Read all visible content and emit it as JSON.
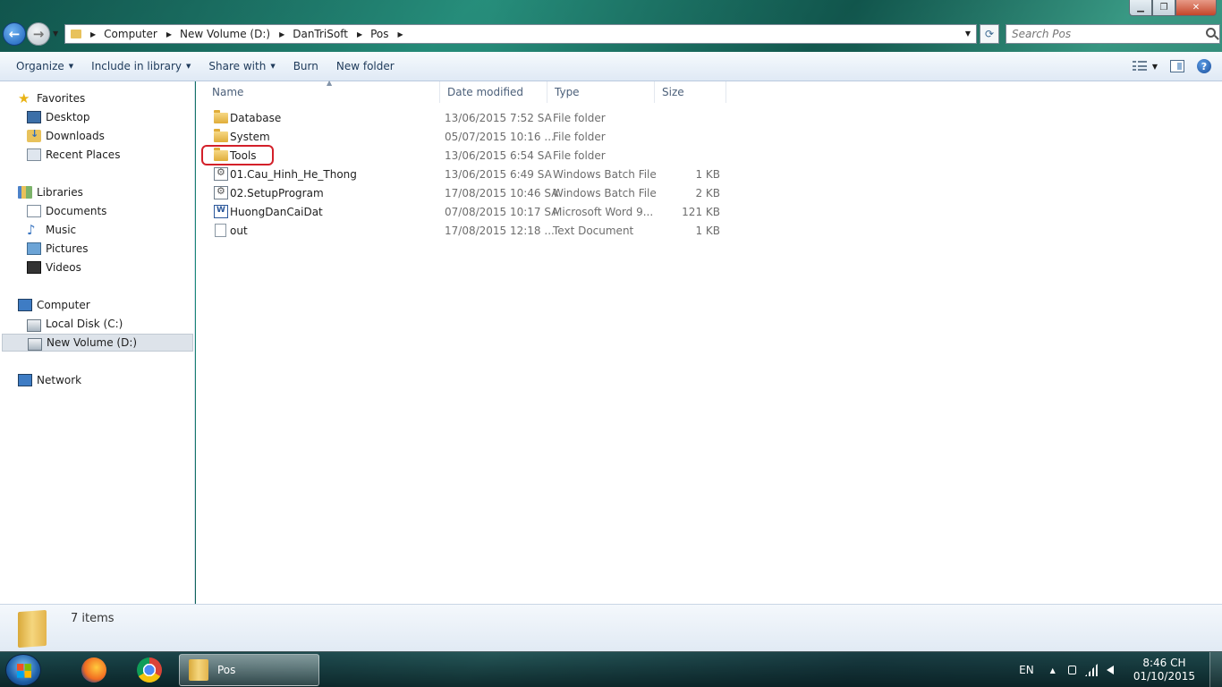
{
  "address": {
    "crumbs": [
      "Computer",
      "New Volume (D:)",
      "DanTriSoft",
      "Pos"
    ],
    "search_placeholder": "Search Pos"
  },
  "toolbar": {
    "organize": "Organize",
    "include_library": "Include in library",
    "share_with": "Share with",
    "burn": "Burn",
    "new_folder": "New folder"
  },
  "nav": {
    "favorites": "Favorites",
    "desktop": "Desktop",
    "downloads": "Downloads",
    "recent_places": "Recent Places",
    "libraries": "Libraries",
    "documents": "Documents",
    "music": "Music",
    "pictures": "Pictures",
    "videos": "Videos",
    "computer": "Computer",
    "local_disk": "Local Disk (C:)",
    "new_volume": "New Volume (D:)",
    "network": "Network"
  },
  "columns": {
    "name": "Name",
    "date": "Date modified",
    "type": "Type",
    "size": "Size"
  },
  "files": [
    {
      "name": "Database",
      "date": "13/06/2015 7:52 SA",
      "type": "File folder",
      "size": "",
      "icon": "folder-icon"
    },
    {
      "name": "System",
      "date": "05/07/2015 10:16 ...",
      "type": "File folder",
      "size": "",
      "icon": "folder-icon"
    },
    {
      "name": "Tools",
      "date": "13/06/2015 6:54 SA",
      "type": "File folder",
      "size": "",
      "icon": "folder-icon"
    },
    {
      "name": "01.Cau_Hinh_He_Thong",
      "date": "13/06/2015 6:49 SA",
      "type": "Windows Batch File",
      "size": "1 KB",
      "icon": "batch-file-icon"
    },
    {
      "name": "02.SetupProgram",
      "date": "17/08/2015 10:46 SA",
      "type": "Windows Batch File",
      "size": "2 KB",
      "icon": "batch-file-icon"
    },
    {
      "name": "HuongDanCaiDat",
      "date": "07/08/2015 10:17 SA",
      "type": "Microsoft Word 9...",
      "size": "121 KB",
      "icon": "word-doc-icon"
    },
    {
      "name": "out",
      "date": "17/08/2015 12:18 ...",
      "type": "Text Document",
      "size": "1 KB",
      "icon": "text-doc-icon"
    }
  ],
  "details": {
    "count": "7 items"
  },
  "taskbar": {
    "active_window": "Pos",
    "language": "EN",
    "time": "8:46 CH",
    "date": "01/10/2015"
  },
  "colors": {
    "selection_highlight": "#d3202a",
    "toolbar_text": "#1e3a5a"
  }
}
